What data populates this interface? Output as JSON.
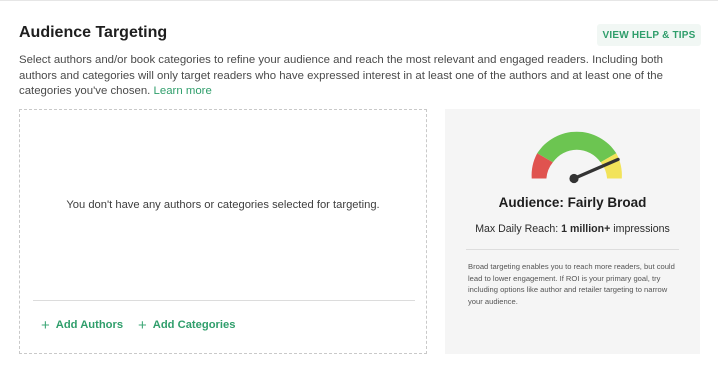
{
  "header": {
    "title": "Audience Targeting",
    "help_button": "VIEW HELP & TIPS"
  },
  "description": {
    "text": "Select authors and/or book categories to refine your audience and reach the most relevant and engaged readers. Including both authors and categories will only target readers who have expressed interest in at least one of the authors and at least one of the categories you've chosen.",
    "link": "Learn more"
  },
  "targeting": {
    "empty_message": "You don't have any authors or categories selected for targeting.",
    "add_authors": "Add Authors",
    "add_categories": "Add Categories"
  },
  "reach": {
    "audience_label": "Audience: Fairly Broad",
    "max_daily_reach_label": "Max Daily Reach:",
    "max_daily_reach_value": "1 million+",
    "max_daily_reach_unit": "impressions",
    "note": "Broad targeting enables you to reach more readers, but could lead to lower engagement. If ROI is your primary goal, try including options like author and retailer targeting to narrow your audience.",
    "gauge_level": 0.87,
    "gauge_colors": {
      "low": "#e0534f",
      "mid": "#6cc551",
      "high": "#f2e35a",
      "needle": "#333333"
    }
  }
}
